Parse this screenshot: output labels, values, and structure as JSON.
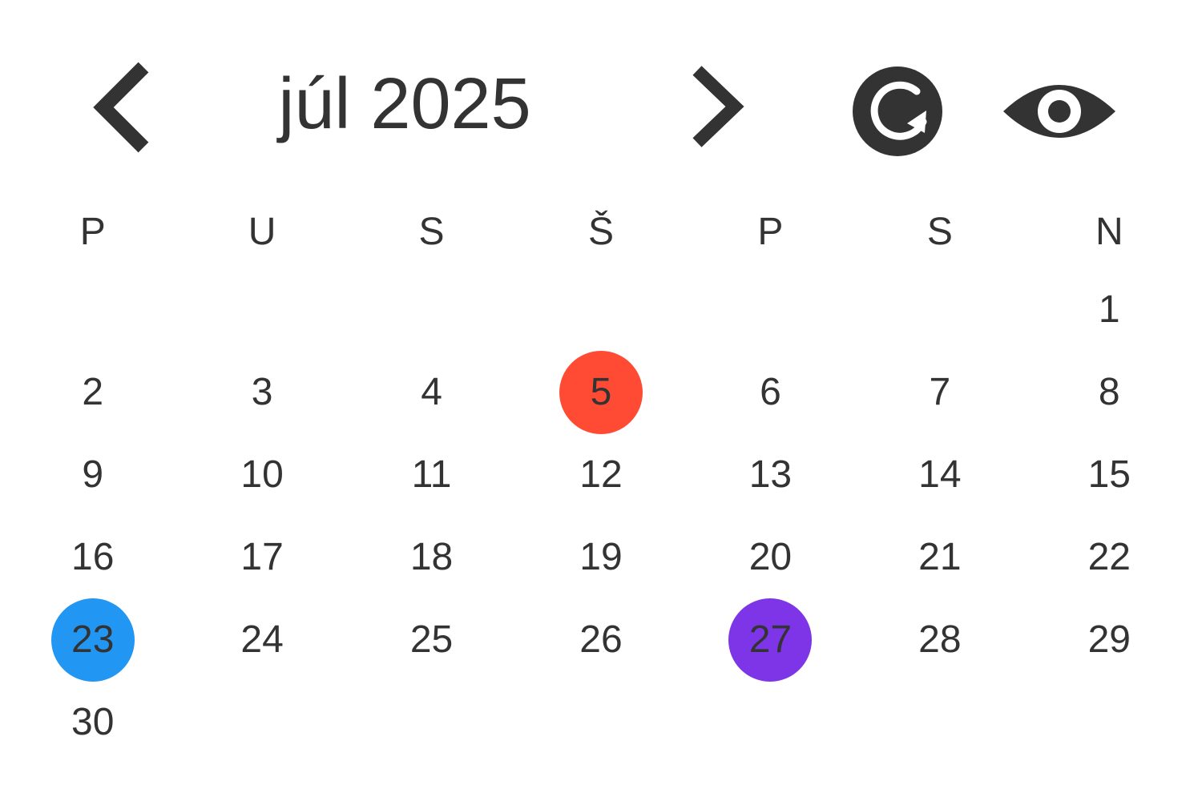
{
  "header": {
    "month_label": "júl 2025",
    "prev_icon": "chevron-left-icon",
    "next_icon": "chevron-right-icon",
    "refresh_icon": "refresh-icon",
    "view_icon": "eye-icon"
  },
  "weekdays": [
    "P",
    "U",
    "S",
    "Š",
    "P",
    "S",
    "N"
  ],
  "leading_empty_days": 6,
  "days": [
    "1",
    "2",
    "3",
    "4",
    "5",
    "6",
    "7",
    "8",
    "9",
    "10",
    "11",
    "12",
    "13",
    "14",
    "15",
    "16",
    "17",
    "18",
    "19",
    "20",
    "21",
    "22",
    "23",
    "24",
    "25",
    "26",
    "27",
    "28",
    "29",
    "30"
  ],
  "highlights": {
    "5": "#ff4b33",
    "23": "#2196f3",
    "27": "#7e35e8"
  },
  "colors": {
    "text": "#333333",
    "background": "#ffffff"
  }
}
